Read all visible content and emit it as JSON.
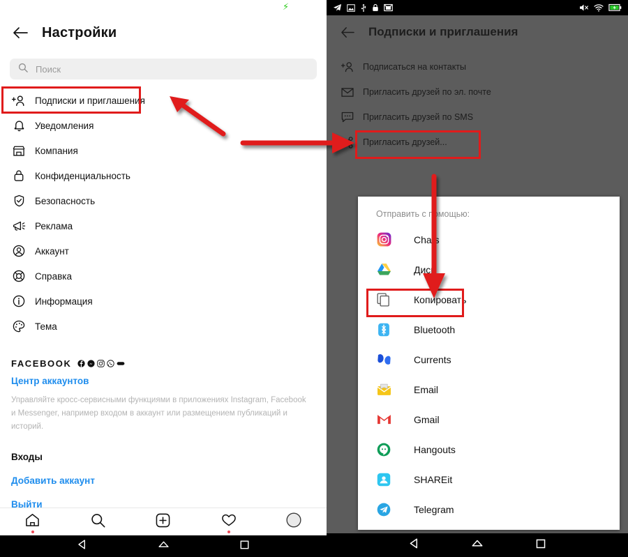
{
  "left_phone": {
    "status_bar": {
      "charging_icon": "charging-bolt-icon"
    },
    "header": {
      "back": "back-arrow-icon",
      "title": "Настройки"
    },
    "search": {
      "placeholder": "Поиск",
      "icon": "search-icon"
    },
    "menu": [
      {
        "icon": "follow-invite-icon",
        "label": "Подписки и приглашения"
      },
      {
        "icon": "bell-icon",
        "label": "Уведомления"
      },
      {
        "icon": "store-icon",
        "label": "Компания"
      },
      {
        "icon": "lock-icon",
        "label": "Конфиденциальность"
      },
      {
        "icon": "shield-check-icon",
        "label": "Безопасность"
      },
      {
        "icon": "megaphone-icon",
        "label": "Реклама"
      },
      {
        "icon": "account-circle-icon",
        "label": "Аккаунт"
      },
      {
        "icon": "lifebuoy-icon",
        "label": "Справка"
      },
      {
        "icon": "info-icon",
        "label": "Информация"
      },
      {
        "icon": "palette-icon",
        "label": "Тема"
      }
    ],
    "facebook": {
      "heading": "FACEBOOK",
      "brand_icons": [
        "facebook-icon",
        "messenger-icon",
        "instagram-icon",
        "whatsapp-icon",
        "oculus-icon"
      ],
      "accounts_center_link": "Центр аккаунтов",
      "description": "Управляйте кросс-сервисными функциями в приложениях Instagram, Facebook и Messenger, например входом в аккаунт или размещением публикаций и историй."
    },
    "logins": {
      "heading": "Входы",
      "add_account": "Добавить аккаунт",
      "logout": "Выйти"
    },
    "bottom_nav": [
      {
        "icon": "home-icon",
        "badge": true
      },
      {
        "icon": "search-icon",
        "badge": false
      },
      {
        "icon": "plus-box-icon",
        "badge": false
      },
      {
        "icon": "heart-icon",
        "badge": true
      },
      {
        "icon": "profile-avatar-icon",
        "badge": false
      }
    ],
    "system_nav": [
      "back-triangle-icon",
      "home-pentagon-icon",
      "recents-square-icon"
    ]
  },
  "right_phone": {
    "status_bar": {
      "left_icons": [
        "telegram-icon",
        "image-icon",
        "usb-icon",
        "lock-icon",
        "mail-icon"
      ],
      "right_icons": [
        "mute-icon",
        "wifi-icon",
        "battery-charging-icon"
      ]
    },
    "header": {
      "back": "back-arrow-icon",
      "title": "Подписки и приглашения"
    },
    "menu": [
      {
        "icon": "follow-invite-icon",
        "label": "Подписаться на контакты"
      },
      {
        "icon": "envelope-icon",
        "label": "Пригласить друзей по эл. почте"
      },
      {
        "icon": "sms-bubble-icon",
        "label": "Пригласить друзей по SMS"
      },
      {
        "icon": "share-nodes-icon",
        "label": "Пригласить друзей..."
      }
    ],
    "share_sheet": {
      "title": "Отправить с помощью:",
      "items": [
        {
          "icon": "instagram-icon",
          "label": "Chats"
        },
        {
          "icon": "google-drive-icon",
          "label": "Диск"
        },
        {
          "icon": "copy-icon",
          "label": "Копировать"
        },
        {
          "icon": "bluetooth-icon",
          "label": "Bluetooth"
        },
        {
          "icon": "currents-icon",
          "label": "Currents"
        },
        {
          "icon": "email-icon",
          "label": "Email"
        },
        {
          "icon": "gmail-icon",
          "label": "Gmail"
        },
        {
          "icon": "hangouts-icon",
          "label": "Hangouts"
        },
        {
          "icon": "shareit-icon",
          "label": "SHAREit"
        },
        {
          "icon": "telegram-icon",
          "label": "Telegram"
        }
      ]
    },
    "system_nav": [
      "back-triangle-icon",
      "home-pentagon-icon",
      "recents-square-icon"
    ]
  },
  "annotations": {
    "highlight_color": "#e01b1b",
    "boxes": [
      "follow-invite-row-left",
      "invite-friends-row-right",
      "copy-row-sheet"
    ],
    "arrows": [
      "arrow-to-follow-invite",
      "arrow-to-invite-friends",
      "arrow-to-copy"
    ]
  }
}
